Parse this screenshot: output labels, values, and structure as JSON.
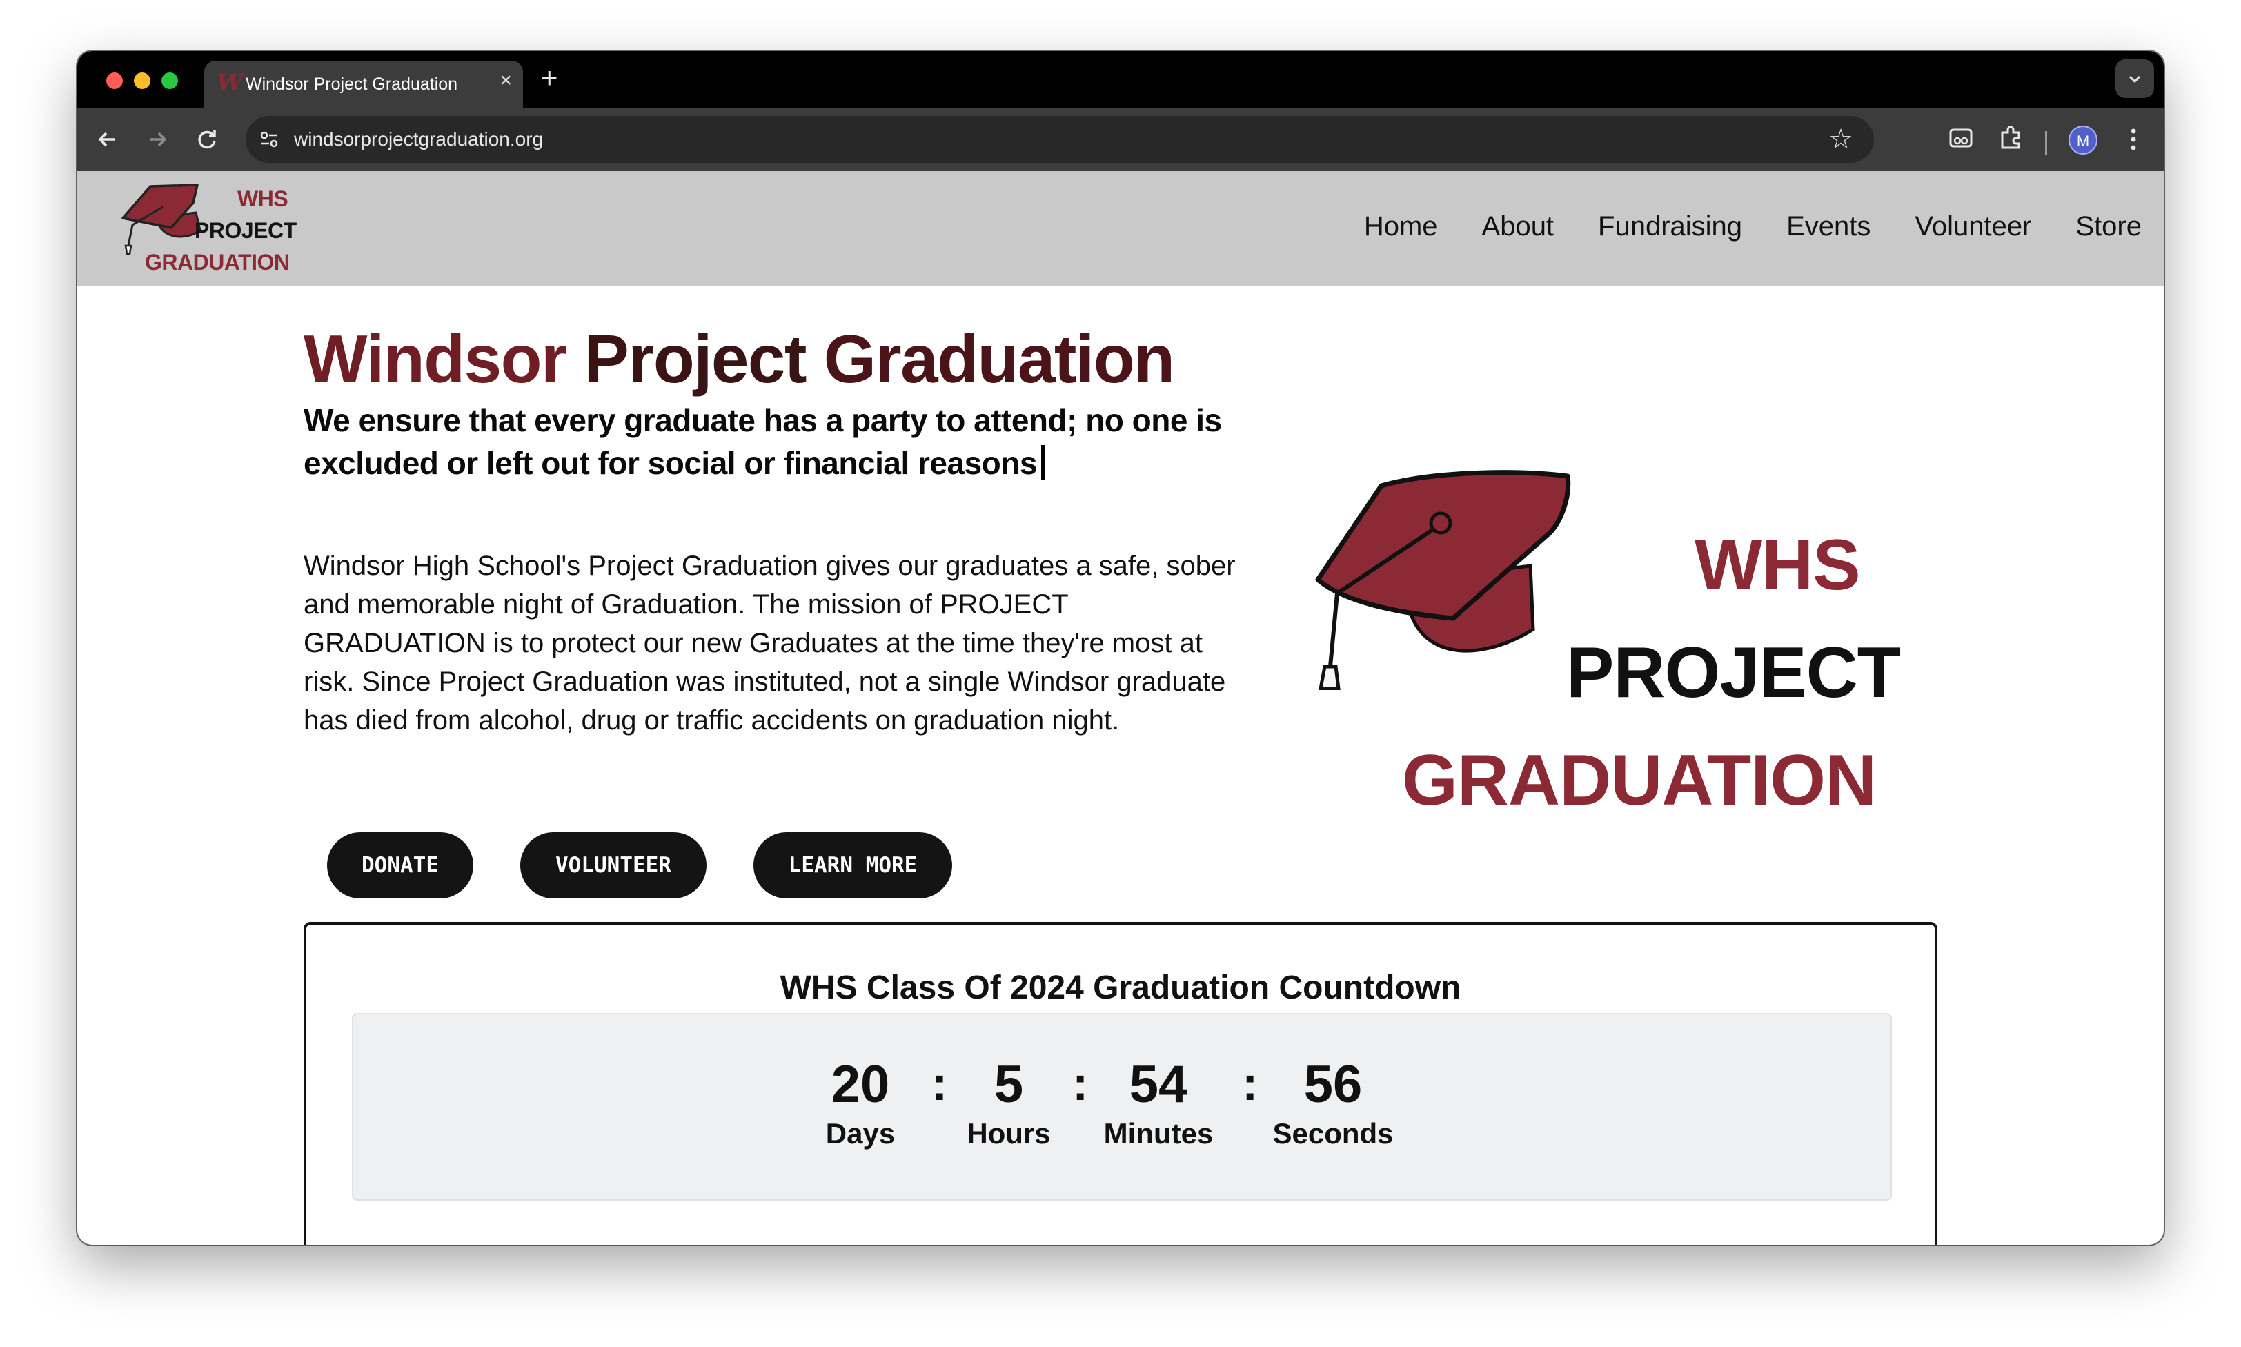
{
  "browser": {
    "tab_title": "Windsor Project Graduation",
    "tab_favicon": "W",
    "url": "windsorprojectgraduation.org",
    "avatar_letter": "M"
  },
  "site": {
    "logo": {
      "line1": "WHS",
      "line2": "PROJECT",
      "line3": "GRADUATION"
    },
    "nav": [
      "Home",
      "About",
      "Fundraising",
      "Events",
      "Volunteer",
      "Store"
    ]
  },
  "hero": {
    "title_part1": "Windsor",
    "title_part2": "Project",
    "title_part3": "Graduation",
    "tagline": "We ensure that every graduate has a party to attend; no one is excluded or left out for social or financial reasons",
    "mission": "Windsor High School's Project Graduation gives our graduates a safe, sober and memorable night of Graduation. The mission of PROJECT GRADUATION is to protect our new Graduates at the time they're most at risk. Since Project Graduation was instituted, not a single Windsor graduate has died from alcohol, drug or traffic accidents on graduation night.",
    "buttons": [
      "DONATE",
      "VOLUNTEER",
      "LEARN MORE"
    ]
  },
  "countdown": {
    "title": "WHS Class Of 2024 Graduation Countdown",
    "separator": ":",
    "units": [
      {
        "value": "20",
        "label": "Days"
      },
      {
        "value": "5",
        "label": "Hours"
      },
      {
        "value": "54",
        "label": "Minutes"
      },
      {
        "value": "56",
        "label": "Seconds"
      }
    ]
  },
  "colors": {
    "brand_maroon": "#8b2a34",
    "header_bg": "#c9c9c9",
    "button_bg": "#141414"
  },
  "icons": [
    "back-arrow-icon",
    "forward-arrow-icon",
    "reload-icon",
    "site-settings-icon",
    "bookmark-star-icon",
    "incognito-icon",
    "extensions-icon",
    "more-menu-icon",
    "graduation-cap-icon"
  ]
}
